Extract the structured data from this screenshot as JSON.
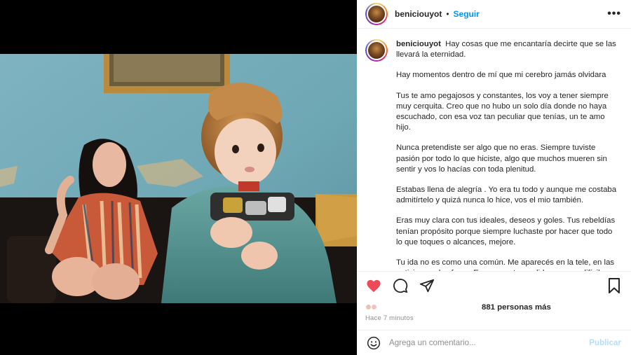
{
  "post": {
    "username": "beniciouyot",
    "follow_label": "Seguir",
    "more_label": "•••",
    "caption_paragraphs": [
      "Hay cosas que me encantaría decirte que se las llevará la eternidad.",
      "Hay momentos dentro de mí que mi cerebro jamás olvidara",
      "Tus te amo pegajosos y constantes, los voy a tener siempre muy cerquita. Creo que no hubo un solo día donde no haya escuchado, con esa voz tan peculiar que tenías, un te amo hijo.",
      "Nunca pretendiste ser algo que no eras. Siempre tuviste pasión por todo lo que hiciste, algo que muchos mueren sin sentir y vos lo hacías con toda plenitud.",
      "Estabas llena de alegría . Yo era tu todo y aunque me costaba admitírtelo y quizá nunca lo hice, vos el mio también.",
      "Eras muy clara con tus ideales, deseos y goles. Tus rebeldías tenían propósito porque siempre luchaste por hacer que todo lo que toques o alcances, mejore.",
      "Tu ida no es como una común. Me aparecés en la tele, en las noticias, en los foros. Escapar esta perdida va a ser difícil. Pero trae algo bueno. Porque mucha gente te admiraba y amaba lo"
    ],
    "likes_text": "881 personas más",
    "time_ago": "Hace 7 minutos",
    "comment_placeholder": "Agrega un comentario...",
    "publish_label": "Publicar"
  },
  "colors": {
    "like_active": "#ed4956",
    "link": "#0095f6",
    "publish_disabled": "#b2dffc"
  },
  "icons": [
    "heart-icon",
    "comment-icon",
    "share-icon",
    "bookmark-icon",
    "emoji-icon",
    "more-icon"
  ]
}
